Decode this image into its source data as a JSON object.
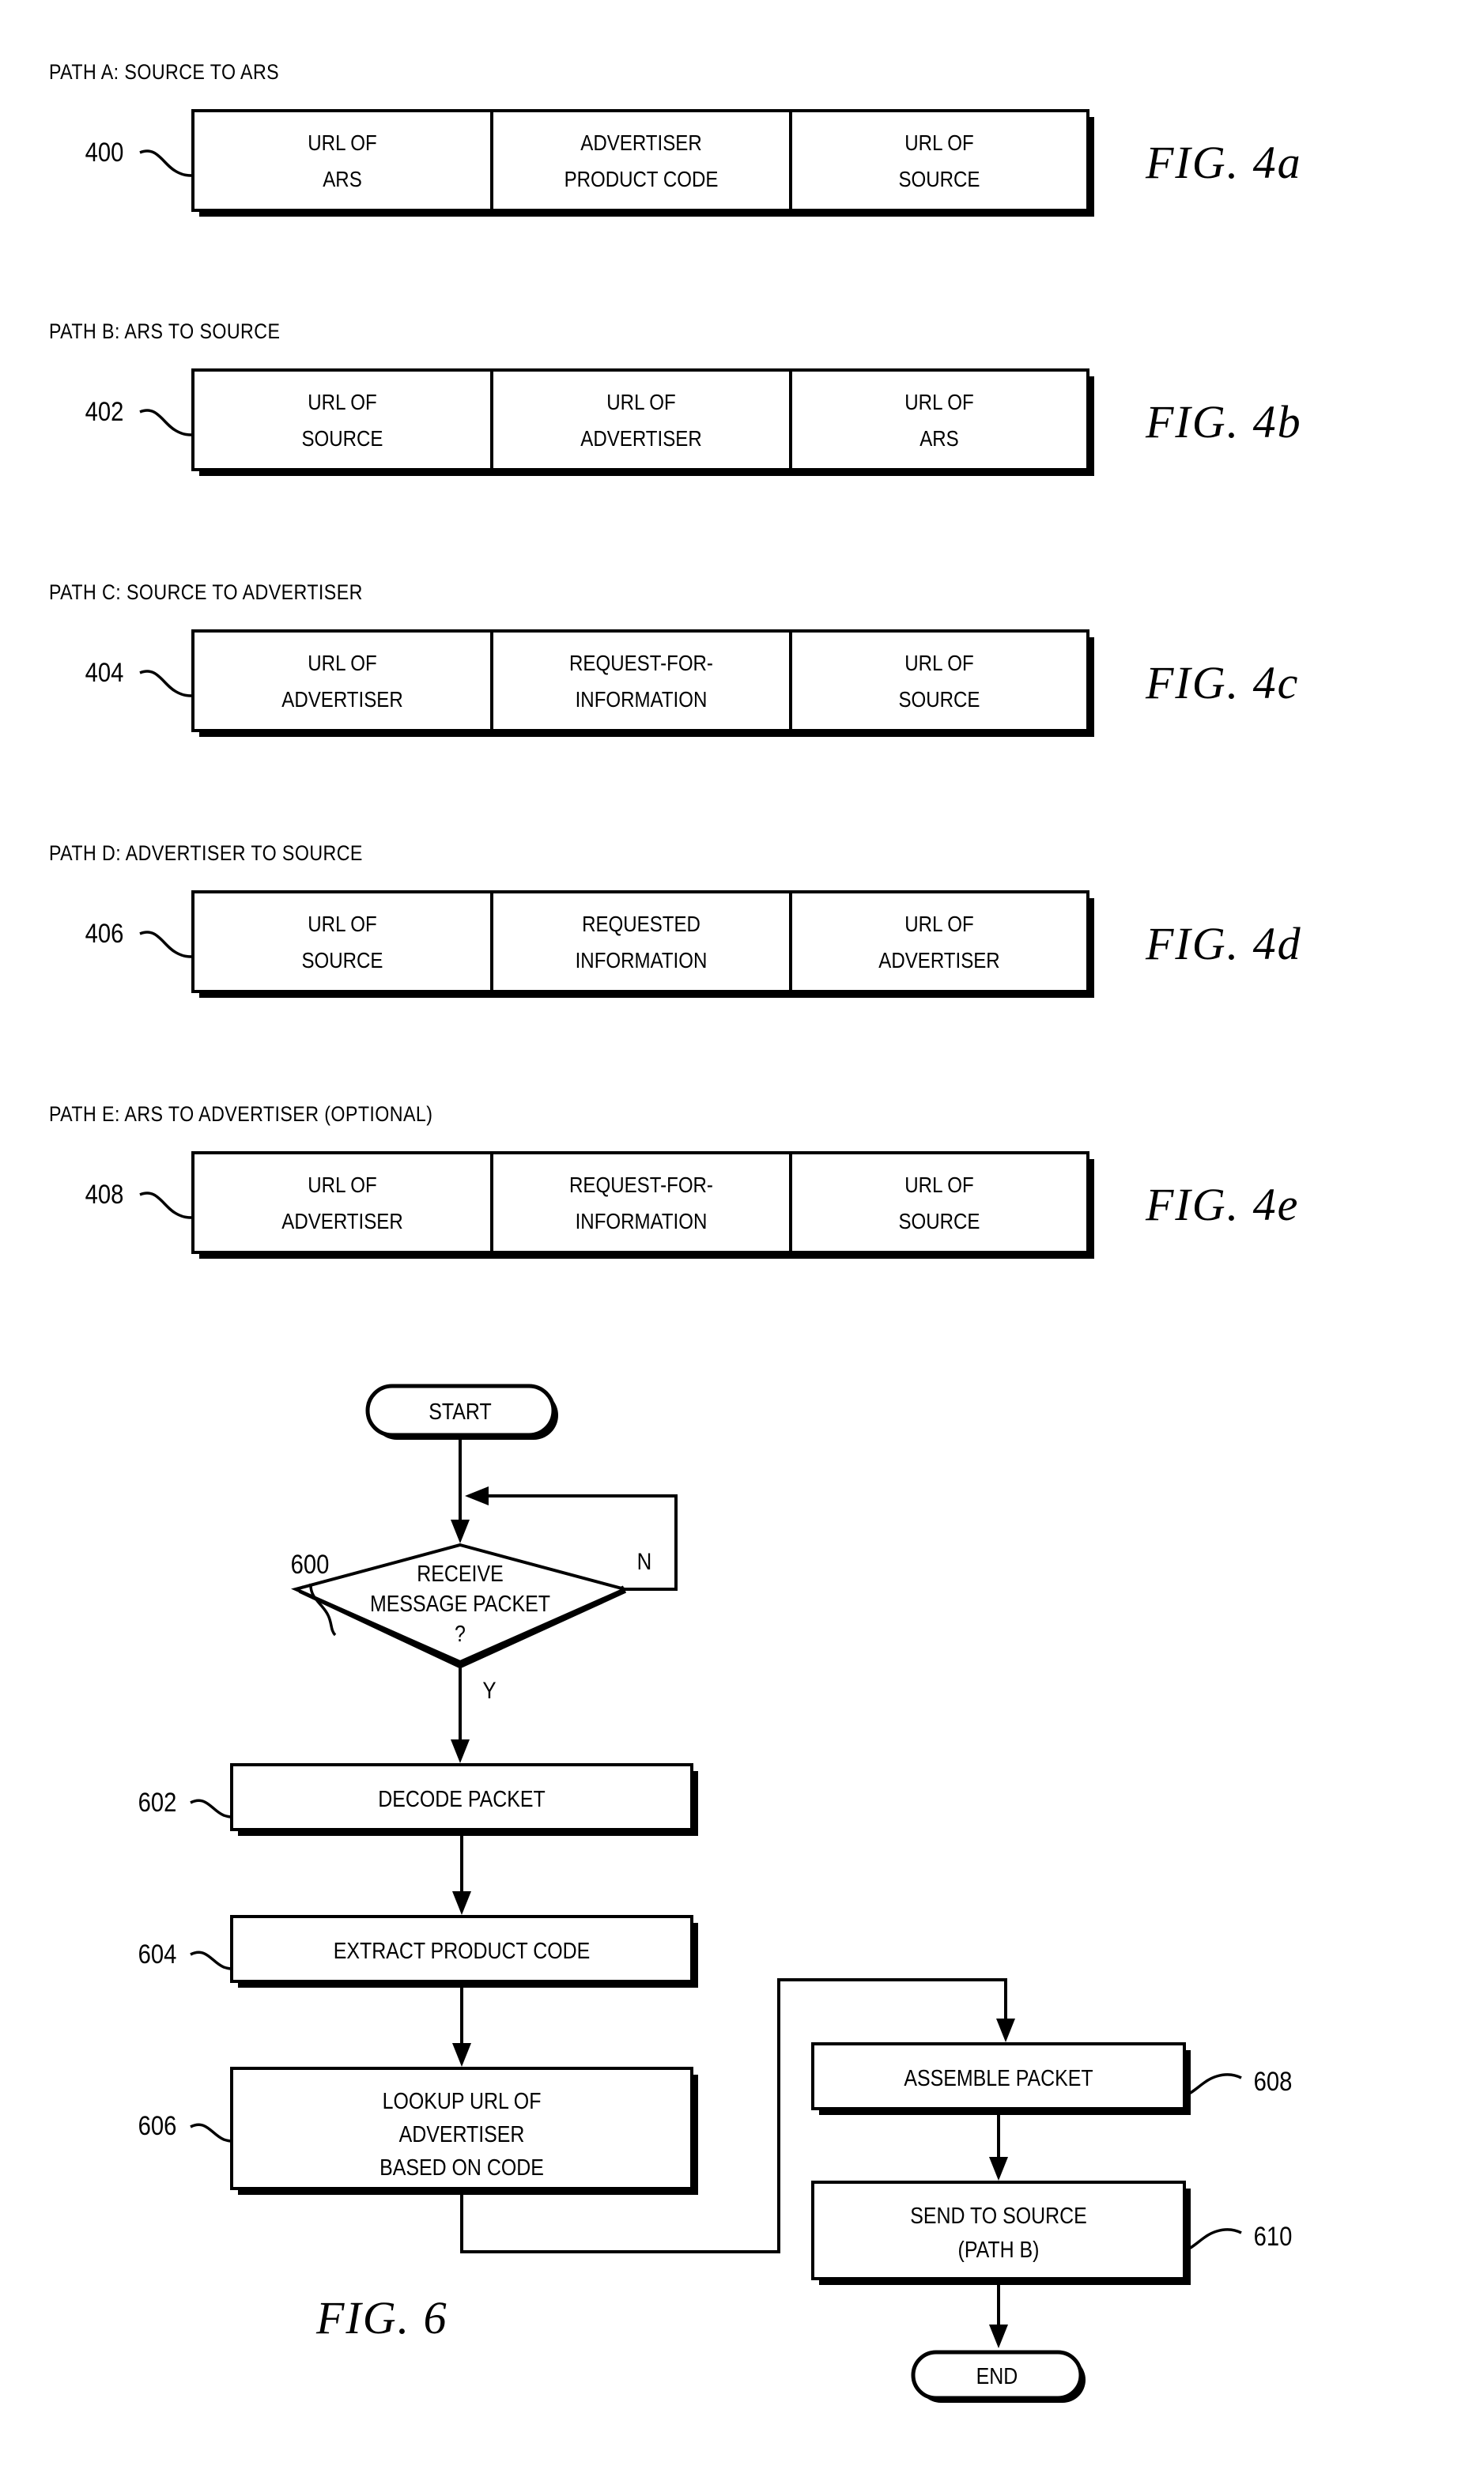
{
  "document": {
    "type": "patent-drawing-sheet",
    "background_color": "#ffffff",
    "ink_color": "#000000"
  },
  "packet_figures": [
    {
      "caption": "PATH A: SOURCE TO ARS",
      "ref": "400",
      "fig_label": "FIG.  4a",
      "cells": [
        {
          "line1": "URL OF",
          "line2": "ARS"
        },
        {
          "line1": "ADVERTISER",
          "line2": "PRODUCT CODE"
        },
        {
          "line1": "URL OF",
          "line2": "SOURCE"
        }
      ]
    },
    {
      "caption": "PATH B: ARS TO SOURCE",
      "ref": "402",
      "fig_label": "FIG.  4b",
      "cells": [
        {
          "line1": "URL OF",
          "line2": "SOURCE"
        },
        {
          "line1": "URL OF",
          "line2": "ADVERTISER"
        },
        {
          "line1": "URL OF",
          "line2": "ARS"
        }
      ]
    },
    {
      "caption": "PATH C: SOURCE TO ADVERTISER",
      "ref": "404",
      "fig_label": "FIG.  4c",
      "cells": [
        {
          "line1": "URL OF",
          "line2": "ADVERTISER"
        },
        {
          "line1": "REQUEST-FOR-",
          "line2": "INFORMATION"
        },
        {
          "line1": "URL OF",
          "line2": "SOURCE"
        }
      ]
    },
    {
      "caption": "PATH D: ADVERTISER TO SOURCE",
      "ref": "406",
      "fig_label": "FIG.  4d",
      "cells": [
        {
          "line1": "URL OF",
          "line2": "SOURCE"
        },
        {
          "line1": "REQUESTED",
          "line2": "INFORMATION"
        },
        {
          "line1": "URL OF",
          "line2": "ADVERTISER"
        }
      ]
    },
    {
      "caption": "PATH E: ARS TO ADVERTISER (OPTIONAL)",
      "ref": "408",
      "fig_label": "FIG.  4e",
      "cells": [
        {
          "line1": "URL OF",
          "line2": "ADVERTISER"
        },
        {
          "line1": "REQUEST-FOR-",
          "line2": "INFORMATION"
        },
        {
          "line1": "URL OF",
          "line2": "SOURCE"
        }
      ]
    }
  ],
  "flowchart": {
    "fig_label": "FIG.  6",
    "terminals": {
      "start": "START",
      "end": "END"
    },
    "decision": {
      "ref": "600",
      "line1": "RECEIVE",
      "line2": "MESSAGE PACKET",
      "line3": "?",
      "yes_label": "Y",
      "no_label": "N"
    },
    "steps": [
      {
        "ref": "602",
        "lines": [
          "DECODE PACKET"
        ]
      },
      {
        "ref": "604",
        "lines": [
          "EXTRACT PRODUCT CODE"
        ]
      },
      {
        "ref": "606",
        "lines": [
          "LOOKUP URL OF",
          "ADVERTISER",
          "BASED ON CODE"
        ]
      },
      {
        "ref": "608",
        "lines": [
          "ASSEMBLE PACKET"
        ]
      },
      {
        "ref": "610",
        "lines": [
          "SEND TO SOURCE",
          "(PATH B)"
        ]
      }
    ]
  }
}
